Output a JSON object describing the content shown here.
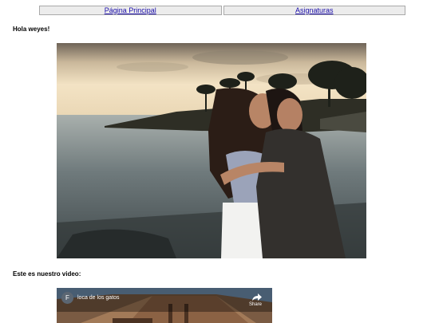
{
  "nav": {
    "home_label": "Página Principal",
    "subjects_label": "Asignaturas"
  },
  "content": {
    "greeting": "Hola weyes!",
    "video_heading": "Este es nuestro video:"
  },
  "video": {
    "channel_initial": "F",
    "title": "loca de los gatos",
    "share_label": "Share"
  },
  "colors": {
    "link": "#1a0dab",
    "nav_button_bg": "#ececec",
    "nav_button_border": "#a9a9a9"
  }
}
